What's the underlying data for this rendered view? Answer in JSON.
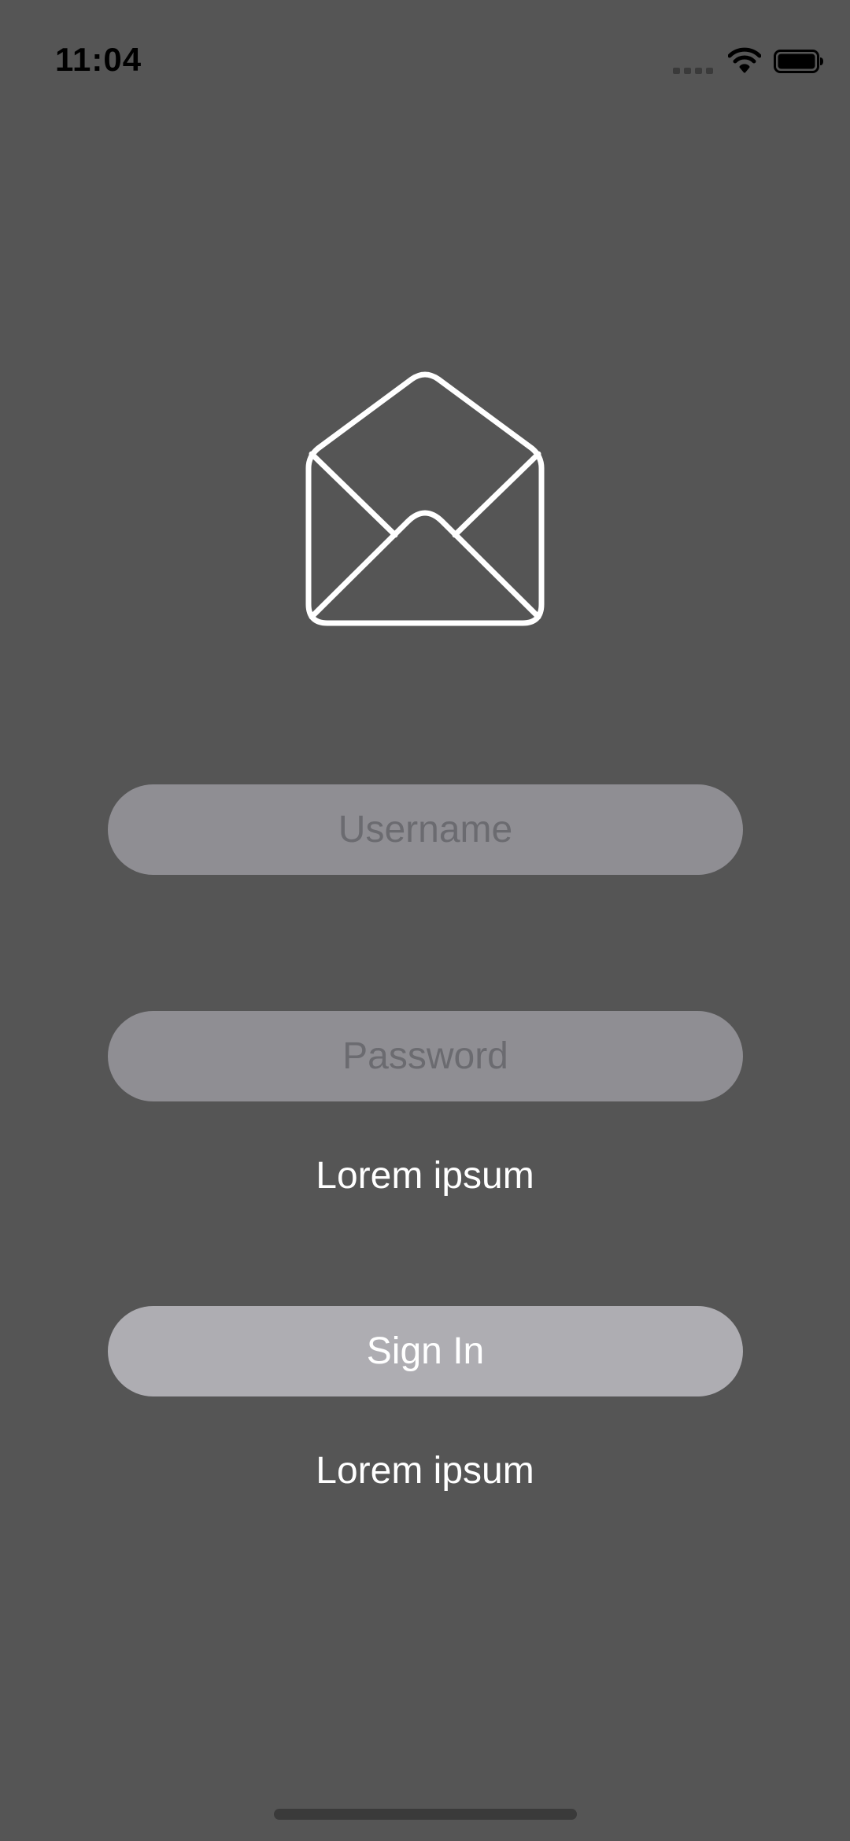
{
  "status_bar": {
    "time": "11:04",
    "icons": [
      "signal-dots-icon",
      "wifi-icon",
      "battery-icon"
    ],
    "color": "#000000"
  },
  "logo": {
    "icon": "envelope-open-icon",
    "color": "#ffffff"
  },
  "form": {
    "username": {
      "placeholder": "Username",
      "value": ""
    },
    "password": {
      "placeholder": "Password",
      "value": ""
    },
    "caption_below_password": "Lorem ipsum",
    "sign_in_label": "Sign In",
    "caption_below_button": "Lorem ipsum"
  },
  "colors": {
    "background": "#555555",
    "input_fill": "#8f8e93",
    "placeholder_text": "#6b6b70",
    "button_fill": "#aeadb2",
    "text": "#ffffff"
  }
}
